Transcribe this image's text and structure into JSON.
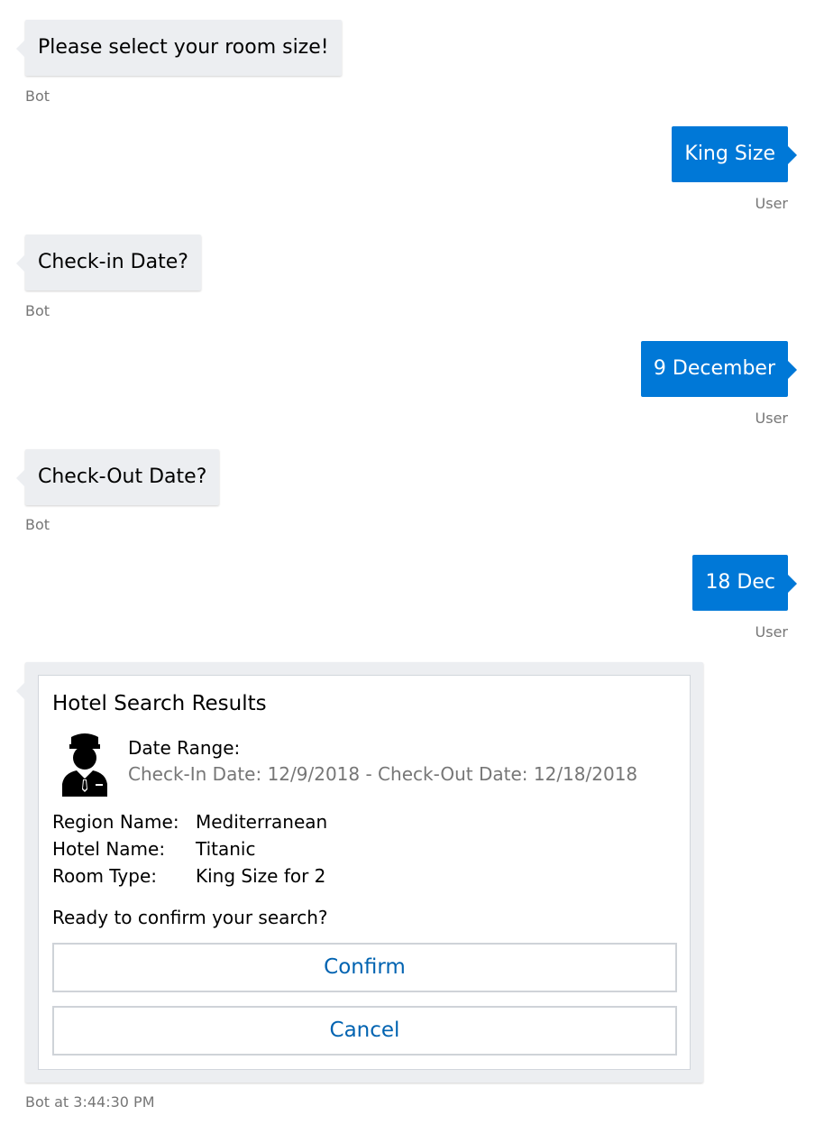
{
  "messages": [
    {
      "from": "bot",
      "text": "Please select your room size!",
      "meta": "Bot"
    },
    {
      "from": "user",
      "text": "King Size",
      "meta": "User"
    },
    {
      "from": "bot",
      "text": "Check-in Date?",
      "meta": "Bot"
    },
    {
      "from": "user",
      "text": "9 December",
      "meta": "User"
    },
    {
      "from": "bot",
      "text": "Check-Out Date?",
      "meta": "Bot"
    },
    {
      "from": "user",
      "text": "18 Dec",
      "meta": "User"
    }
  ],
  "card": {
    "title": "Hotel Search Results",
    "icon": "concierge-icon",
    "date_label": "Date Range:",
    "date_value": "Check-In Date: 12/9/2018 - Check-Out Date: 12/18/2018",
    "facts": [
      {
        "key": "Region Name:",
        "value": "Mediterranean"
      },
      {
        "key": "Hotel Name:",
        "value": "Titanic"
      },
      {
        "key": "Room Type:",
        "value": "King Size for 2"
      }
    ],
    "question": "Ready to confirm your search?",
    "confirm_label": "Confirm",
    "cancel_label": "Cancel",
    "meta": "Bot at 3:44:30 PM"
  },
  "colors": {
    "user_bubble": "#0078d7",
    "bot_bubble": "#eceef1",
    "button_text": "#0063b1",
    "meta_text": "#767676"
  }
}
